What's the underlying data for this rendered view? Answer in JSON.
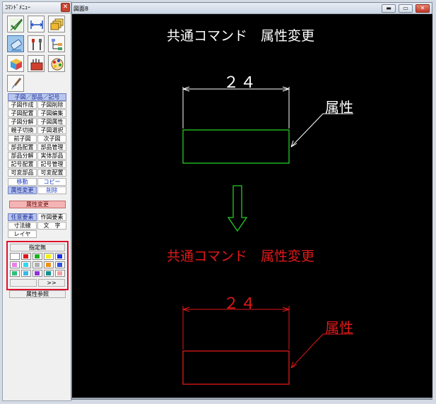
{
  "panel": {
    "title": "ｺﾏﾝﾄﾞﾒﾆｭｰ",
    "close": "✕",
    "icons": [
      "check-icon",
      "dimension-icon",
      "layers-icon",
      "eraser-icon",
      "tools-icon",
      "tree-icon",
      "cube-icon",
      "toolbox-icon",
      "palette-icon",
      "brush-icon"
    ],
    "header": "子図／部品／記号",
    "rows": [
      [
        "子図作成",
        "子図削除"
      ],
      [
        "子図配置",
        "子図編集"
      ],
      [
        "子図分解",
        "子図属性"
      ],
      [
        "親子切換",
        "子図選択"
      ],
      [
        "前子図",
        "次子図"
      ],
      [
        "部品配置",
        "部品管理"
      ],
      [
        "部品分解",
        "実体部品"
      ],
      [
        "記号配置",
        "記号管理"
      ],
      [
        "可変部品",
        "可変配置"
      ]
    ],
    "move": "移動",
    "copy": "コピー",
    "attr_change": "属性変更",
    "delete": "削除",
    "attr_change_title": "属性変更",
    "any_element": "任意要素",
    "drawn_element": "作図要素",
    "dim_line": "寸法線",
    "text_label": "文　字",
    "layer": "レイヤ",
    "unspecified": "指定無",
    "more": ">>",
    "attr_ref": "属性参照",
    "swatches": [
      "#ffffff",
      "#e0141e",
      "#20b020",
      "#f0f018",
      "#1830e8",
      "#e880e8",
      "#30d8f0",
      "#b0b0b0",
      "#f09018",
      "#3050e0",
      "#30c078",
      "#38b8e8",
      "#9030d8",
      "#109090",
      "#f0a0a0"
    ]
  },
  "window": {
    "title": "図面8",
    "min": "▬",
    "max": "▭",
    "close": "✕"
  },
  "drawing": {
    "top_title": "共通コマンド　属性変更",
    "top_dim": "２４",
    "top_label": "属性",
    "bottom_title": "共通コマンド　属性変更",
    "bottom_dim": "２４",
    "bottom_label": "属性",
    "colors": {
      "white": "#ffffff",
      "green": "#22cc22",
      "red": "#e01818",
      "arrow": "#22cc22"
    }
  }
}
